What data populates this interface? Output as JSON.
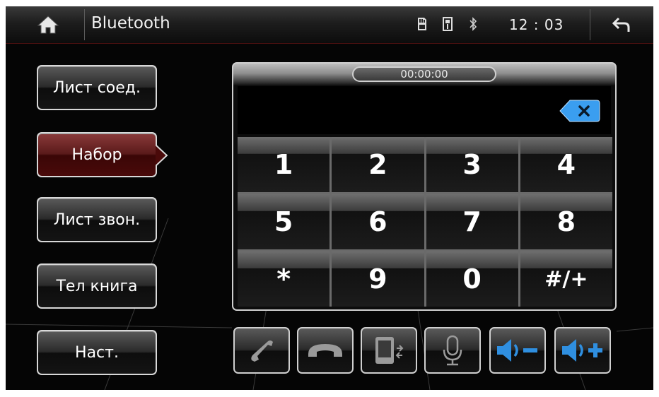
{
  "header": {
    "title": "Bluetooth",
    "clock": "12 : 03"
  },
  "menu": {
    "items": [
      {
        "label": "Лист соед."
      },
      {
        "label": "Набор"
      },
      {
        "label": "Лист звон."
      },
      {
        "label": "Тел книга"
      },
      {
        "label": "Наст."
      }
    ]
  },
  "dialer": {
    "timer": "00:00:00",
    "number": "",
    "keys": [
      "1",
      "2",
      "3",
      "4",
      "5",
      "6",
      "7",
      "8",
      "*",
      "9",
      "0",
      "#/+"
    ]
  },
  "colors": {
    "active_menu": "#5a1a1a",
    "accent_blue": "#2f8fe0",
    "background": "#050505"
  },
  "icons": [
    "home-icon",
    "sd-card-icon",
    "usb-icon",
    "bluetooth-icon",
    "back-icon",
    "backspace-icon",
    "call-icon",
    "hangup-icon",
    "transfer-icon",
    "mic-icon",
    "volume-down-icon",
    "volume-up-icon"
  ]
}
